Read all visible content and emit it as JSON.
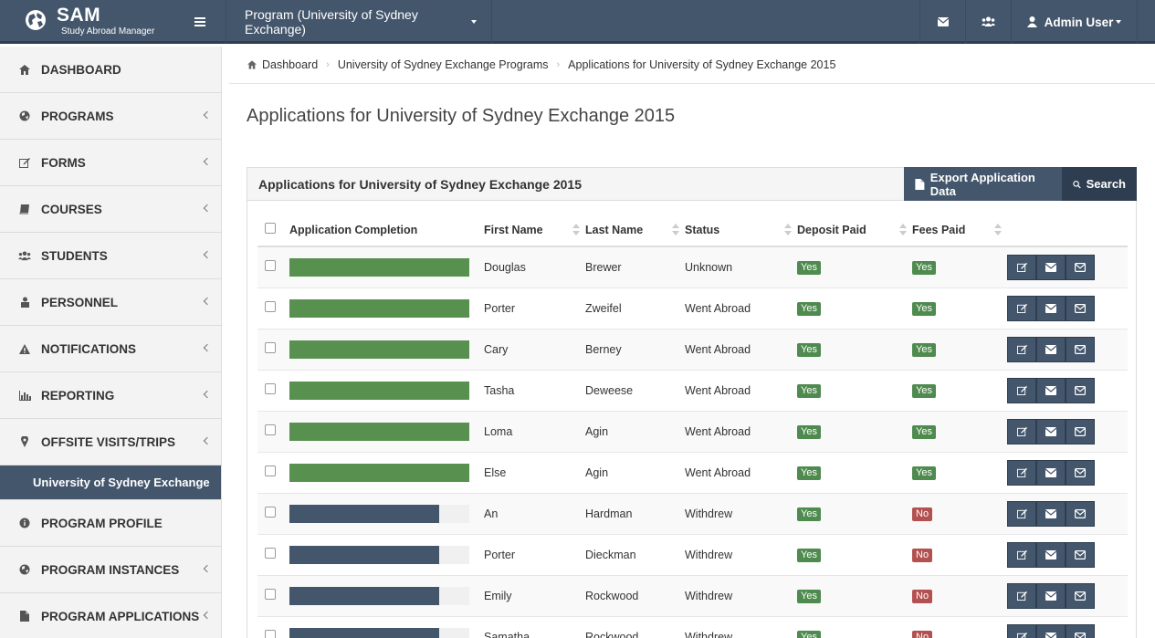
{
  "brand": {
    "title": "SAM",
    "subtitle": "Study Abroad Manager"
  },
  "topbar": {
    "program_label": "Program (University of Sydney Exchange)",
    "user_label": "Admin User"
  },
  "sidebar": {
    "items": [
      {
        "label": "DASHBOARD",
        "icon": "home-icon",
        "chevron": false
      },
      {
        "label": "PROGRAMS",
        "icon": "globe-icon",
        "chevron": true
      },
      {
        "label": "FORMS",
        "icon": "edit-icon",
        "chevron": true
      },
      {
        "label": "COURSES",
        "icon": "book-icon",
        "chevron": true
      },
      {
        "label": "STUDENTS",
        "icon": "users-icon",
        "chevron": true
      },
      {
        "label": "PERSONNEL",
        "icon": "person-icon",
        "chevron": true
      },
      {
        "label": "NOTIFICATIONS",
        "icon": "warning-icon",
        "chevron": true
      },
      {
        "label": "REPORTING",
        "icon": "chart-icon",
        "chevron": true
      },
      {
        "label": "OFFSITE VISITS/TRIPS",
        "icon": "map-marker-icon",
        "chevron": true
      }
    ],
    "active_program": "University of Sydney Exchange",
    "sub_items": [
      {
        "label": "PROGRAM PROFILE",
        "icon": "info-icon",
        "chevron": false
      },
      {
        "label": "PROGRAM INSTANCES",
        "icon": "globe-icon",
        "chevron": true
      },
      {
        "label": "PROGRAM APPLICATIONS",
        "icon": "file-icon",
        "chevron": true
      }
    ]
  },
  "breadcrumb": {
    "items": [
      "Dashboard",
      "University of Sydney Exchange Programs",
      "Applications for University of Sydney Exchange 2015"
    ]
  },
  "page": {
    "title": "Applications for University of Sydney Exchange 2015"
  },
  "panel": {
    "title": "Applications for University of Sydney Exchange 2015",
    "export_label": "Export Application Data",
    "search_label": "Search"
  },
  "table": {
    "headers": [
      "Application Completion",
      "First Name",
      "Last Name",
      "Status",
      "Deposit Paid",
      "Fees Paid"
    ],
    "rows": [
      {
        "completion": 1.0,
        "first": "Douglas",
        "last": "Brewer",
        "status": "Unknown",
        "deposit": "Yes",
        "fees": "Yes"
      },
      {
        "completion": 1.0,
        "first": "Porter",
        "last": "Zweifel",
        "status": "Went Abroad",
        "deposit": "Yes",
        "fees": "Yes"
      },
      {
        "completion": 1.0,
        "first": "Cary",
        "last": "Berney",
        "status": "Went Abroad",
        "deposit": "Yes",
        "fees": "Yes"
      },
      {
        "completion": 1.0,
        "first": "Tasha",
        "last": "Deweese",
        "status": "Went Abroad",
        "deposit": "Yes",
        "fees": "Yes"
      },
      {
        "completion": 1.0,
        "first": "Loma",
        "last": "Agin",
        "status": "Went Abroad",
        "deposit": "Yes",
        "fees": "Yes"
      },
      {
        "completion": 1.0,
        "first": "Else",
        "last": "Agin",
        "status": "Went Abroad",
        "deposit": "Yes",
        "fees": "Yes"
      },
      {
        "completion": 0.83,
        "first": "An",
        "last": "Hardman",
        "status": "Withdrew",
        "deposit": "Yes",
        "fees": "No"
      },
      {
        "completion": 0.83,
        "first": "Porter",
        "last": "Dieckman",
        "status": "Withdrew",
        "deposit": "Yes",
        "fees": "No"
      },
      {
        "completion": 0.83,
        "first": "Emily",
        "last": "Rockwood",
        "status": "Withdrew",
        "deposit": "Yes",
        "fees": "No"
      },
      {
        "completion": 0.83,
        "first": "Samatha",
        "last": "Rockwood",
        "status": "Withdrew",
        "deposit": "Yes",
        "fees": "No"
      }
    ]
  },
  "colors": {
    "complete": "#57904f",
    "partial": "#44566c",
    "nav": "#44566c",
    "yes": "#4f8a4f",
    "no": "#b35050"
  }
}
